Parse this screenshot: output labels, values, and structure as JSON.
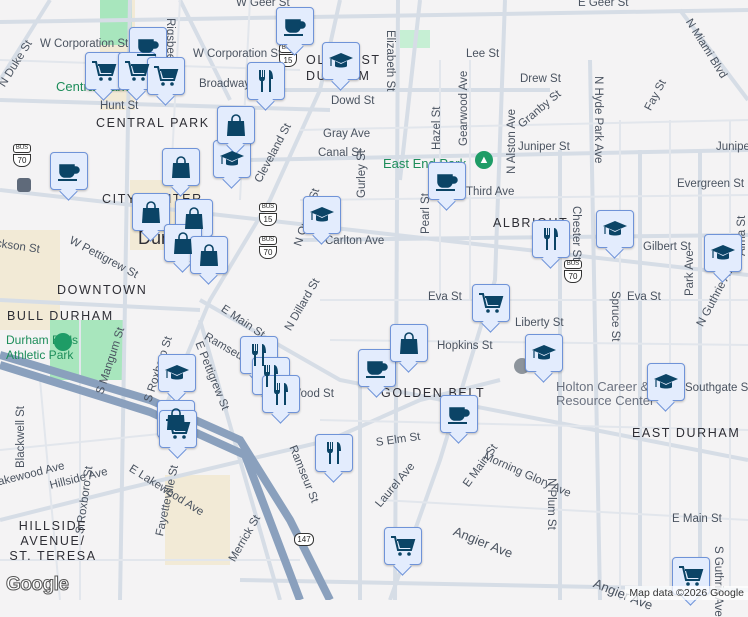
{
  "streets": {
    "w_geer": "W Geer St",
    "e_geer": "E Geer St",
    "n_duke": "N Duke St",
    "w_corp1": "W Corporation St",
    "w_corp2": "W Corporation St",
    "rigsbee": "Rigsbee Ave",
    "broadway": "Broadway St",
    "hunt": "Hunt St",
    "dowd": "Dowd St",
    "gray": "Gray Ave",
    "canal": "Canal St",
    "cleveland": "Cleveland St",
    "gurley": "Gurley St",
    "elizabeth": "Elizabeth St",
    "lee": "Lee St",
    "drew": "Drew St",
    "hazel": "Hazel St",
    "gearwood": "Gearwood Ave",
    "granby": "Granby St",
    "n_alston": "N Alston Ave",
    "juniper": "Juniper St",
    "juniper2": "Juniper St",
    "n_hyde_park": "N Hyde Park Ave",
    "fay": "Fay St",
    "n_miami": "N Miami Blvd",
    "evergreen": "Evergreen St",
    "pearl": "Pearl St",
    "third": "Third Ave",
    "chester": "Chester St",
    "gilbert": "Gilbert St",
    "carlton": "Carlton Ave",
    "n_queen": "N Queen St",
    "jackson": "Jackson St",
    "w_pettigrew": "W Pettigrew St",
    "eva": "Eva St",
    "eva2": "Eva St",
    "e_main": "E Main St",
    "n_dillard": "N Dillard St",
    "liberty": "Liberty St",
    "hopkins": "Hopkins St",
    "ramseur": "Ramseur St",
    "e_pettigrew": "E Pettigrew St",
    "s_mangum": "S Mangum St",
    "s_roxboro_n": "S Roxboro St",
    "wood": "Wood St",
    "blackwell": "Blackwell St",
    "lakewood": "Lakewood Ave",
    "hillside": "Hillside Ave",
    "s_roxboro": "S Roxboro St",
    "e_lakewood": "E Lakewood Ave",
    "fayetteville": "Fayetteville St",
    "ramseur2": "Ramseur St",
    "s_elm": "S Elm St",
    "merrick": "Merrick St",
    "laurel": "Laurel Ave",
    "morning_glory": "Morning Glory Ave",
    "e_main2": "E Main St",
    "e_main3": "E Main St",
    "angier": "Angier Ave",
    "angier2": "Angier Ave",
    "n_plum": "N Plum St",
    "spruce": "Spruce St",
    "park": "Park Ave",
    "n_guthrie": "N Guthrie Ave",
    "s_guthrie": "S Guthrie Ave",
    "southgate": "Southgate St",
    "alma": "Alma St"
  },
  "neighborhoods": {
    "central_park": "CENTRAL PARK",
    "old_east": "OLD EAST DURHAM",
    "city_center": "CITY CENTER",
    "durham": "Durham",
    "downtown": "DOWNTOWN",
    "bull_durham": "BULL DURHAM",
    "albright": "ALBRIGHT",
    "golden_belt": "GOLDEN BELT",
    "east_durham": "EAST DURHAM",
    "hillside": "HILLSIDE AVENUE/ ST. TERESA"
  },
  "parks": {
    "central_park": "Central Park",
    "east_end": "East End Park",
    "bulls": "Durham Bulls Athletic Park"
  },
  "pois": {
    "holton": "Holton Career & Resource Center"
  },
  "shields": [
    {
      "type": "BUS",
      "num": "15"
    },
    {
      "type": "BUS",
      "num": "70"
    },
    {
      "type": "BUS",
      "num": "15"
    },
    {
      "type": "BUS",
      "num": "70"
    },
    {
      "type": "BUS",
      "num": "70"
    },
    {
      "type": "",
      "num": "147"
    }
  ],
  "markers": [
    {
      "icon": "coffee-icon"
    },
    {
      "icon": "coffee-icon"
    },
    {
      "icon": "coffee-icon"
    },
    {
      "icon": "coffee-icon"
    },
    {
      "icon": "coffee-icon"
    },
    {
      "icon": "coffee-icon"
    },
    {
      "icon": "graduation-cap-icon"
    },
    {
      "icon": "graduation-cap-icon"
    },
    {
      "icon": "graduation-cap-icon"
    },
    {
      "icon": "graduation-cap-icon"
    },
    {
      "icon": "graduation-cap-icon"
    },
    {
      "icon": "graduation-cap-icon"
    },
    {
      "icon": "graduation-cap-icon"
    },
    {
      "icon": "graduation-cap-icon"
    },
    {
      "icon": "restaurant-icon"
    },
    {
      "icon": "restaurant-icon"
    },
    {
      "icon": "restaurant-icon"
    },
    {
      "icon": "restaurant-icon"
    },
    {
      "icon": "restaurant-icon"
    },
    {
      "icon": "restaurant-icon"
    },
    {
      "icon": "shopping-bag-icon"
    },
    {
      "icon": "shopping-bag-icon"
    },
    {
      "icon": "shopping-bag-icon"
    },
    {
      "icon": "shopping-bag-icon"
    },
    {
      "icon": "shopping-bag-icon"
    },
    {
      "icon": "shopping-bag-icon"
    },
    {
      "icon": "shopping-bag-icon"
    },
    {
      "icon": "shopping-bag-icon"
    },
    {
      "icon": "shopping-cart-icon"
    },
    {
      "icon": "shopping-cart-icon"
    },
    {
      "icon": "shopping-cart-icon"
    },
    {
      "icon": "shopping-cart-icon"
    },
    {
      "icon": "shopping-cart-icon"
    },
    {
      "icon": "shopping-cart-icon"
    },
    {
      "icon": "shopping-cart-icon"
    }
  ],
  "colors": {
    "marker_fill": "#e3ecfd",
    "marker_border": "#6f93d8",
    "icon": "#0b4466",
    "park": "#a8e6bd",
    "highway": "#8aa0bd"
  },
  "footer": {
    "logo": "Google",
    "credit": "Map data ©2026 Google"
  }
}
